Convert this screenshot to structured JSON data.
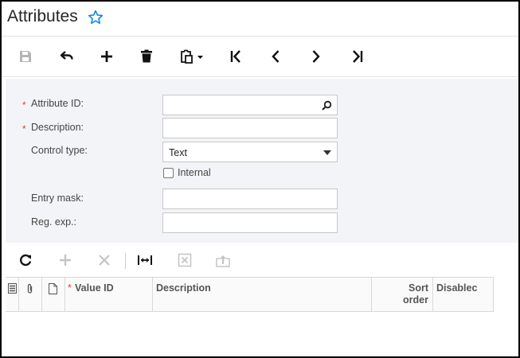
{
  "header": {
    "title": "Attributes",
    "favorite_icon": "star-outline-icon"
  },
  "toolbar": {
    "buttons": [
      "save-icon",
      "undo-icon",
      "add-icon",
      "delete-icon",
      "clipboard-icon",
      "first-record-icon",
      "previous-record-icon",
      "next-record-icon",
      "last-record-icon"
    ]
  },
  "form": {
    "attribute_id": {
      "label": "Attribute ID:",
      "value": "",
      "required": true
    },
    "description": {
      "label": "Description:",
      "value": "",
      "required": true
    },
    "control_type": {
      "label": "Control type:",
      "value": "Text"
    },
    "internal": {
      "label": "Internal",
      "checked": false
    },
    "entry_mask": {
      "label": "Entry mask:",
      "value": ""
    },
    "reg_exp": {
      "label": "Reg. exp.:",
      "value": ""
    },
    "required_marker": "*"
  },
  "grid": {
    "toolbar": [
      "refresh-icon",
      "add-row-icon",
      "delete-row-icon",
      "fit-columns-icon",
      "export-excel-icon",
      "upload-icon"
    ],
    "columns": {
      "value_id": "Value ID",
      "description": "Description",
      "sort_order": "Sort order",
      "disabled": "Disablec"
    }
  },
  "colors": {
    "accent": "#1a8cd8",
    "required": "#e0383e",
    "form_bg": "#f3f4f7"
  }
}
